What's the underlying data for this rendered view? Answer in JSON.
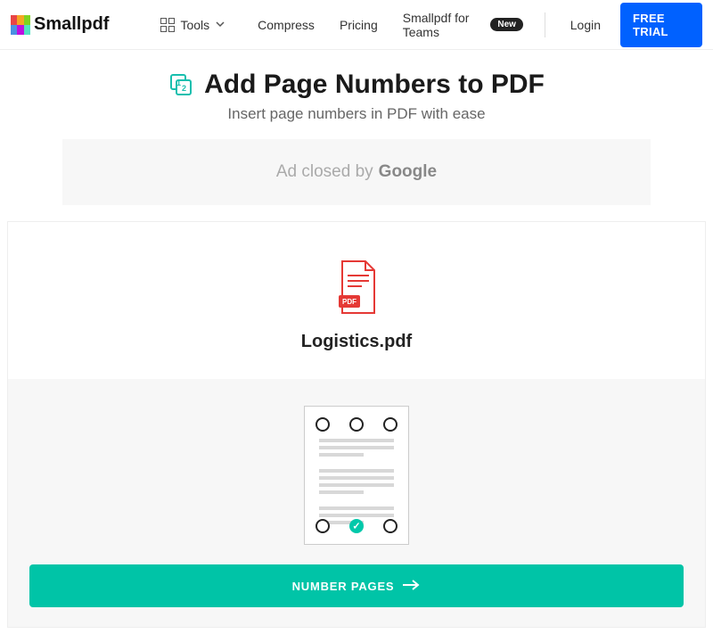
{
  "header": {
    "brand": "Smallpdf",
    "nav": {
      "tools": "Tools",
      "compress": "Compress",
      "pricing": "Pricing",
      "teams": "Smallpdf for Teams",
      "teams_badge": "New",
      "login": "Login",
      "free_trial": "FREE TRIAL"
    }
  },
  "hero": {
    "title": "Add Page Numbers to PDF",
    "subtitle": "Insert page numbers in PDF with ease"
  },
  "ad": {
    "text": "Ad closed by",
    "by": "Google"
  },
  "file": {
    "name": "Logistics.pdf"
  },
  "position": {
    "selected": "bottom-center"
  },
  "action": {
    "button": "NUMBER PAGES"
  },
  "colors": {
    "primary_blue": "#0061ff",
    "teal": "#00c4a7"
  }
}
